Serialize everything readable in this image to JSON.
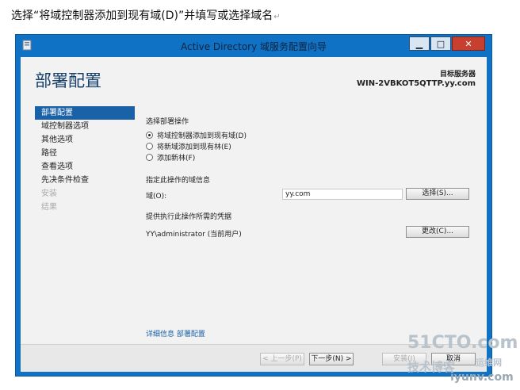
{
  "caption": {
    "text": "选择“将域控制器添加到现有域(D)”并填写或选择域名",
    "mark": "↵"
  },
  "window": {
    "title": "Active Directory 域服务配置向导",
    "app_icon": "server-icon",
    "controls": {
      "minimize": "▁",
      "maximize": "□",
      "close": "✕"
    }
  },
  "header": {
    "page_title": "部署配置",
    "target_label": "目标服务器",
    "target_value": "WIN-2VBKOT5QTTP.yy.com"
  },
  "nav": {
    "items": [
      {
        "label": "部署配置",
        "state": "active"
      },
      {
        "label": "域控制器选项",
        "state": "normal"
      },
      {
        "label": "其他选项",
        "state": "normal"
      },
      {
        "label": "路径",
        "state": "normal"
      },
      {
        "label": "查看选项",
        "state": "normal"
      },
      {
        "label": "先决条件检查",
        "state": "normal"
      },
      {
        "label": "安装",
        "state": "disabled"
      },
      {
        "label": "结果",
        "state": "disabled"
      }
    ]
  },
  "content": {
    "operation_label": "选择部署操作",
    "options": [
      {
        "label": "将域控制器添加到现有域(D)",
        "checked": true
      },
      {
        "label": "将新域添加到现有林(E)",
        "checked": false
      },
      {
        "label": "添加新林(F)",
        "checked": false
      }
    ],
    "domain_info_label": "指定此操作的域信息",
    "domain_field_label": "域(O):",
    "domain_value": "yy.com",
    "select_button": "选择(S)...",
    "credentials_label": "提供执行此操作所需的凭据",
    "credentials_value": "YY\\administrator (当前用户)",
    "change_button": "更改(C)...",
    "more_link": "详细信息 部署配置"
  },
  "footer": {
    "prev": "< 上一步(P)",
    "next": "下一步(N) >",
    "install": "安装(I)",
    "cancel": "取消"
  },
  "watermark": {
    "site": "51CTO.com",
    "blog": "技术博客",
    "brand": "运维网",
    "url": "iyunv.com"
  }
}
